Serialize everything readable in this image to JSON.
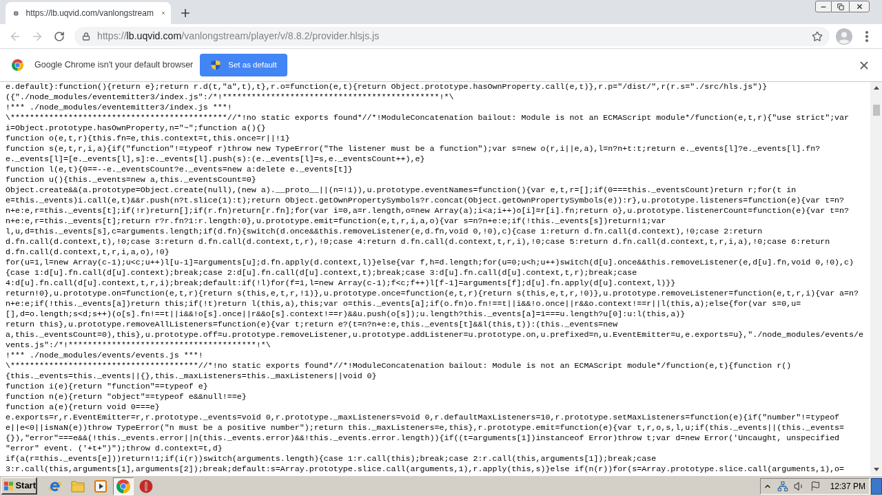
{
  "tabs": [
    {
      "title": "https://lb.uqvid.com/vanlongstream",
      "selected": true
    }
  ],
  "toolbar": {
    "back": {
      "disabled": true
    },
    "forward": {
      "disabled": true
    },
    "address": {
      "scheme": "https://",
      "host": "lb.uqvid.com",
      "path": "/vanlongstream/player/v/8.8.2/provider.hlsjs.js"
    }
  },
  "infobar": {
    "message": "Google Chrome isn't your default browser",
    "button": "Set as default"
  },
  "code_lines": [
    "e.default}:function(){return e};return r.d(t,\"a\",t),t},r.o=function(e,t){return Object.prototype.hasOwnProperty.call(e,t)},r.p=\"/dist/\",r(r.s=\"./src/hls.js\")}",
    "({\"./node_modules/eventemitter3/index.js\":/*!*********************************************!*\\",
    "!*** ./node_modules/eventemitter3/index.js ***!",
    "\\*********************************************//*!no static exports found*//*!ModuleConcatenation bailout: Module is not an ECMAScript module*/function(e,t,r){\"use strict\";var",
    "i=Object.prototype.hasOwnProperty,n=\"~\";function a(){}",
    "function o(e,t,r){this.fn=e,this.context=t,this.once=r||!1}",
    "function s(e,t,r,i,a){if(\"function\"!=typeof r)throw new TypeError(\"The listener must be a function\");var s=new o(r,i||e,a),l=n?n+t:t;return e._events[l]?e._events[l].fn?",
    "e._events[l]=[e._events[l],s]:e._events[l].push(s):(e._events[l]=s,e._eventsCount++),e}",
    "function l(e,t){0==--e._eventsCount?e._events=new a:delete e._events[t]}",
    "function u(){this._events=new a,this._eventsCount=0}",
    "Object.create&&(a.prototype=Object.create(null),(new a).__proto__||(n=!1)),u.prototype.eventNames=function(){var e,t,r=[];if(0===this._eventsCount)return r;for(t in",
    "e=this._events)i.call(e,t)&&r.push(n?t.slice(1):t);return Object.getOwnPropertySymbols?r.concat(Object.getOwnPropertySymbols(e)):r},u.prototype.listeners=function(e){var t=n?",
    "n+e:e,r=this._events[t];if(!r)return[];if(r.fn)return[r.fn];for(var i=0,a=r.length,o=new Array(a);i<a;i++)o[i]=r[i].fn;return o},u.prototype.listenerCount=function(e){var t=n?",
    "n+e:e,r=this._events[t];return r?r.fn?1:r.length:0},u.prototype.emit=function(e,t,r,i,a,o){var s=n?n+e:e;if(!this._events[s])return!1;var",
    "l,u,d=this._events[s],c=arguments.length;if(d.fn){switch(d.once&&this.removeListener(e,d.fn,void 0,!0),c){case 1:return d.fn.call(d.context),!0;case 2:return",
    "d.fn.call(d.context,t),!0;case 3:return d.fn.call(d.context,t,r),!0;case 4:return d.fn.call(d.context,t,r,i),!0;case 5:return d.fn.call(d.context,t,r,i,a),!0;case 6:return",
    "d.fn.call(d.context,t,r,i,a,o),!0}",
    "for(u=1,l=new Array(c-1);u<c;u++)l[u-1]=arguments[u];d.fn.apply(d.context,l)}else{var f,h=d.length;for(u=0;u<h;u++)switch(d[u].once&&this.removeListener(e,d[u].fn,void 0,!0),c)",
    "{case 1:d[u].fn.call(d[u].context);break;case 2:d[u].fn.call(d[u].context,t);break;case 3:d[u].fn.call(d[u].context,t,r);break;case",
    "4:d[u].fn.call(d[u].context,t,r,i);break;default:if(!l)for(f=1,l=new Array(c-1);f<c;f++)l[f-1]=arguments[f];d[u].fn.apply(d[u].context,l)}}",
    "return!0},u.prototype.on=function(e,t,r){return s(this,e,t,r,!1)},u.prototype.once=function(e,t,r){return s(this,e,t,r,!0)},u.prototype.removeListener=function(e,t,r,i){var a=n?",
    "n+e:e;if(!this._events[a])return this;if(!t)return l(this,a),this;var o=this._events[a];if(o.fn)o.fn!==t||i&&!o.once||r&&o.context!==r||l(this,a);else{for(var s=0,u=",
    "[],d=o.length;s<d;s++)(o[s].fn!==t||i&&!o[s].once||r&&o[s].context!==r)&&u.push(o[s]);u.length?this._events[a]=1===u.length?u[0]:u:l(this,a)}",
    "return this},u.prototype.removeAllListeners=function(e){var t;return e?(t=n?n+e:e,this._events[t]&&l(this,t)):(this._events=new",
    "a,this._eventsCount=0),this},u.prototype.off=u.prototype.removeListener,u.prototype.addListener=u.prototype.on,u.prefixed=n,u.EventEmitter=u,e.exports=u},\"./node_modules/events/e",
    "vents.js\":/*!***************************************!*\\",
    "!*** ./node_modules/events/events.js ***!",
    "\\***************************************//*!no static exports found*//*!ModuleConcatenation bailout: Module is not an ECMAScript module*/function(e,t){function r()",
    "{this._events=this._events||{},this._maxListeners=this._maxListeners||void 0}",
    "function i(e){return \"function\"==typeof e}",
    "function n(e){return \"object\"==typeof e&&null!==e}",
    "function a(e){return void 0===e}",
    "e.exports=r,r.EventEmitter=r,r.prototype._events=void 0,r.prototype._maxListeners=void 0,r.defaultMaxListeners=10,r.prototype.setMaxListeners=function(e){if(\"number\"!=typeof",
    "e||e<0||isNaN(e))throw TypeError(\"n must be a positive number\");return this._maxListeners=e,this},r.prototype.emit=function(e){var t,r,o,s,l,u;if(this._events||(this._events=",
    "{}),\"error\"===e&&(!this._events.error||n(this._events.error)&&!this._events.error.length)){if((t=arguments[1])instanceof Error)throw t;var d=new Error('Uncaught, unspecified",
    "\"error\" event. ('+t+\")\");throw d.context=t,d}",
    "if(a(r=this._events[e]))return!1;if(i(r))switch(arguments.length){case 1:r.call(this);break;case 2:r.call(this,arguments[1]);break;case",
    "3:r.call(this,arguments[1],arguments[2]);break;default:s=Array.prototype.slice.call(arguments,1),r.apply(this,s)}else if(n(r))for(s=Array.prototype.slice.call(arguments,1),o="
  ],
  "taskbar": {
    "start": "Start",
    "items": [
      {
        "kind": "ie",
        "selected": false
      },
      {
        "kind": "folder",
        "selected": false
      },
      {
        "kind": "media",
        "selected": false
      },
      {
        "kind": "chrome",
        "selected": true
      },
      {
        "kind": "alert",
        "selected": false
      }
    ],
    "clock": "12:37 PM"
  }
}
